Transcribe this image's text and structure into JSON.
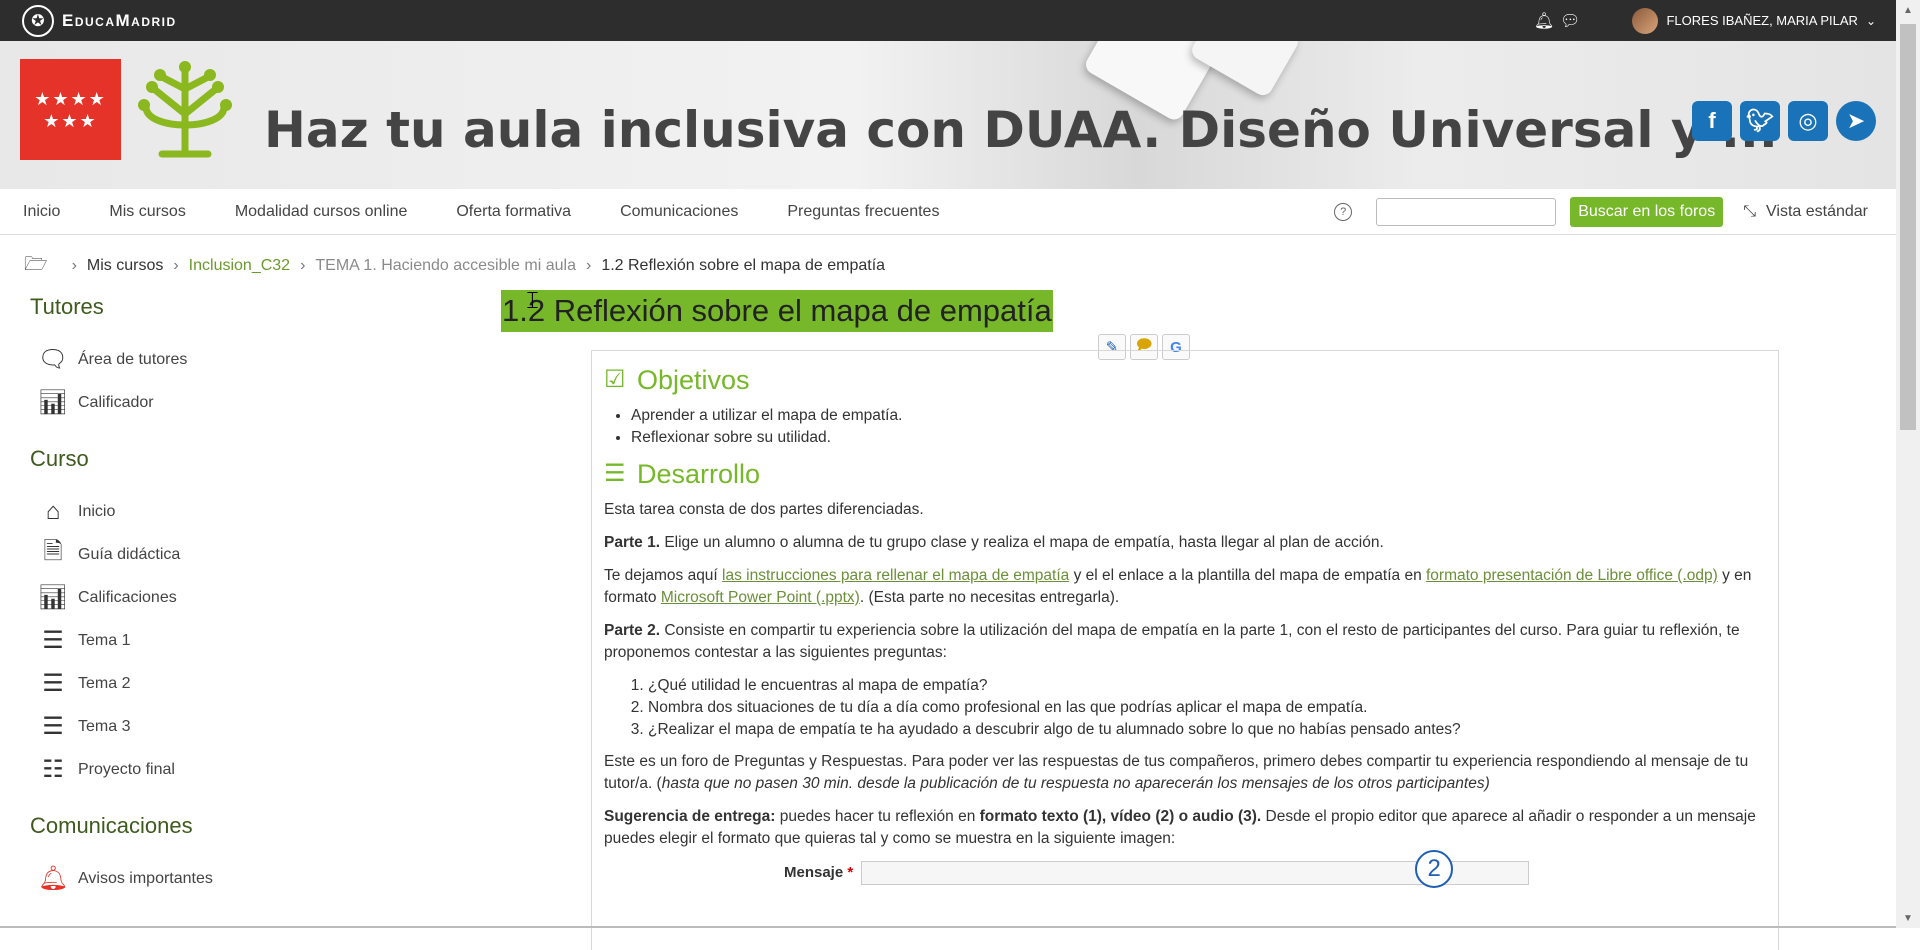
{
  "topbar": {
    "brand": "EducaMadrid",
    "user": "FLORES IBAÑEZ, MARIA PILAR"
  },
  "header": {
    "title": "Haz tu aula inclusiva con DUAA. Diseño Universal y ..."
  },
  "nav": {
    "items": [
      "Inicio",
      "Mis cursos",
      "Modalidad cursos online",
      "Oferta formativa",
      "Comunicaciones",
      "Preguntas frecuentes"
    ],
    "search_button": "Buscar en los foros",
    "search_value": "",
    "view_toggle": "Vista estándar"
  },
  "breadcrumb": [
    "Mis cursos",
    "Inclusion_C32",
    "TEMA 1. Haciendo accesible mi aula",
    "1.2 Reflexión sobre el mapa de empatía"
  ],
  "sidebar": {
    "tutores": {
      "heading": "Tutores",
      "items": [
        {
          "label": "Área de tutores",
          "icon": "comments-icon"
        },
        {
          "label": "Calificador",
          "icon": "bar-chart-icon"
        }
      ]
    },
    "curso": {
      "heading": "Curso",
      "items": [
        {
          "label": "Inicio",
          "icon": "home-icon"
        },
        {
          "label": "Guía didáctica",
          "icon": "document-icon"
        },
        {
          "label": "Calificaciones",
          "icon": "bar-chart-icon"
        },
        {
          "label": "Tema 1",
          "icon": "numbered-list-icon"
        },
        {
          "label": "Tema 2",
          "icon": "numbered-list-icon"
        },
        {
          "label": "Tema 3",
          "icon": "numbered-list-icon"
        },
        {
          "label": "Proyecto final",
          "icon": "server-icon"
        }
      ]
    },
    "comunicaciones": {
      "heading": "Comunicaciones",
      "items": [
        {
          "label": "Avisos importantes",
          "icon": "bell-icon"
        }
      ]
    }
  },
  "content": {
    "page_heading": "1.2 Reflexión sobre el mapa de empatía",
    "objetivos_title": "Objetivos",
    "objetivos": [
      "Aprender a utilizar el mapa de empatía.",
      "Reflexionar sobre su utilidad."
    ],
    "desarrollo_title": "Desarrollo",
    "intro": "Esta tarea consta de dos partes diferenciadas.",
    "parte1_label": "Parte 1.",
    "parte1_text": " Elige un alumno o alumna de tu grupo clase y realiza el mapa de empatía, hasta llegar al plan de acción.",
    "p2_a": "Te dejamos aquí ",
    "p2_link1": "las instrucciones para rellenar el mapa de empatía",
    "p2_b": " y el el enlace a la plantilla del mapa de empatía en ",
    "p2_link2": "formato presentación de Libre office (.odp)",
    "p2_c": " y en formato ",
    "p2_link3": "Microsoft Power Point (.pptx)",
    "p2_d": ". (Esta parte no necesitas entregarla).",
    "parte2_label": "Parte 2.",
    "parte2_text": " Consiste en compartir tu experiencia sobre la utilización del mapa de empatía en la parte 1, con el resto de participantes del curso. Para guiar tu reflexión, te proponemos contestar a las siguientes preguntas:",
    "preguntas": [
      "¿Qué utilidad le encuentras al mapa de empatía?",
      "Nombra dos situaciones de tu día a día como profesional en las que podrías aplicar el mapa de empatía.",
      "¿Realizar el mapa de empatía te ha ayudado a descubrir algo de tu alumnado sobre lo que no habías pensado antes?"
    ],
    "foro_text": "Este es un foro de Preguntas y Respuestas. Para poder ver las respuestas de tus compañeros, primero debes compartir tu experiencia respondiendo al mensaje de tu tutor/a. (",
    "foro_italic": "hasta que no pasen 30 min. desde la publicación de tu respuesta no aparecerán los mensajes de los otros participantes)",
    "sug_label": "Sugerencia de entrega:",
    "sug_a": " puedes hacer tu reflexión en ",
    "sug_bold": "formato texto (1), vídeo (2) o audio (3).",
    "sug_b": " Desde el propio editor que aparece al añadir o responder a un mensaje puedes elegir el formato que quieras tal y como se muestra en la siguiente imagen:",
    "editor_label": "Mensaje",
    "editor_required": "*",
    "badge": "2"
  }
}
